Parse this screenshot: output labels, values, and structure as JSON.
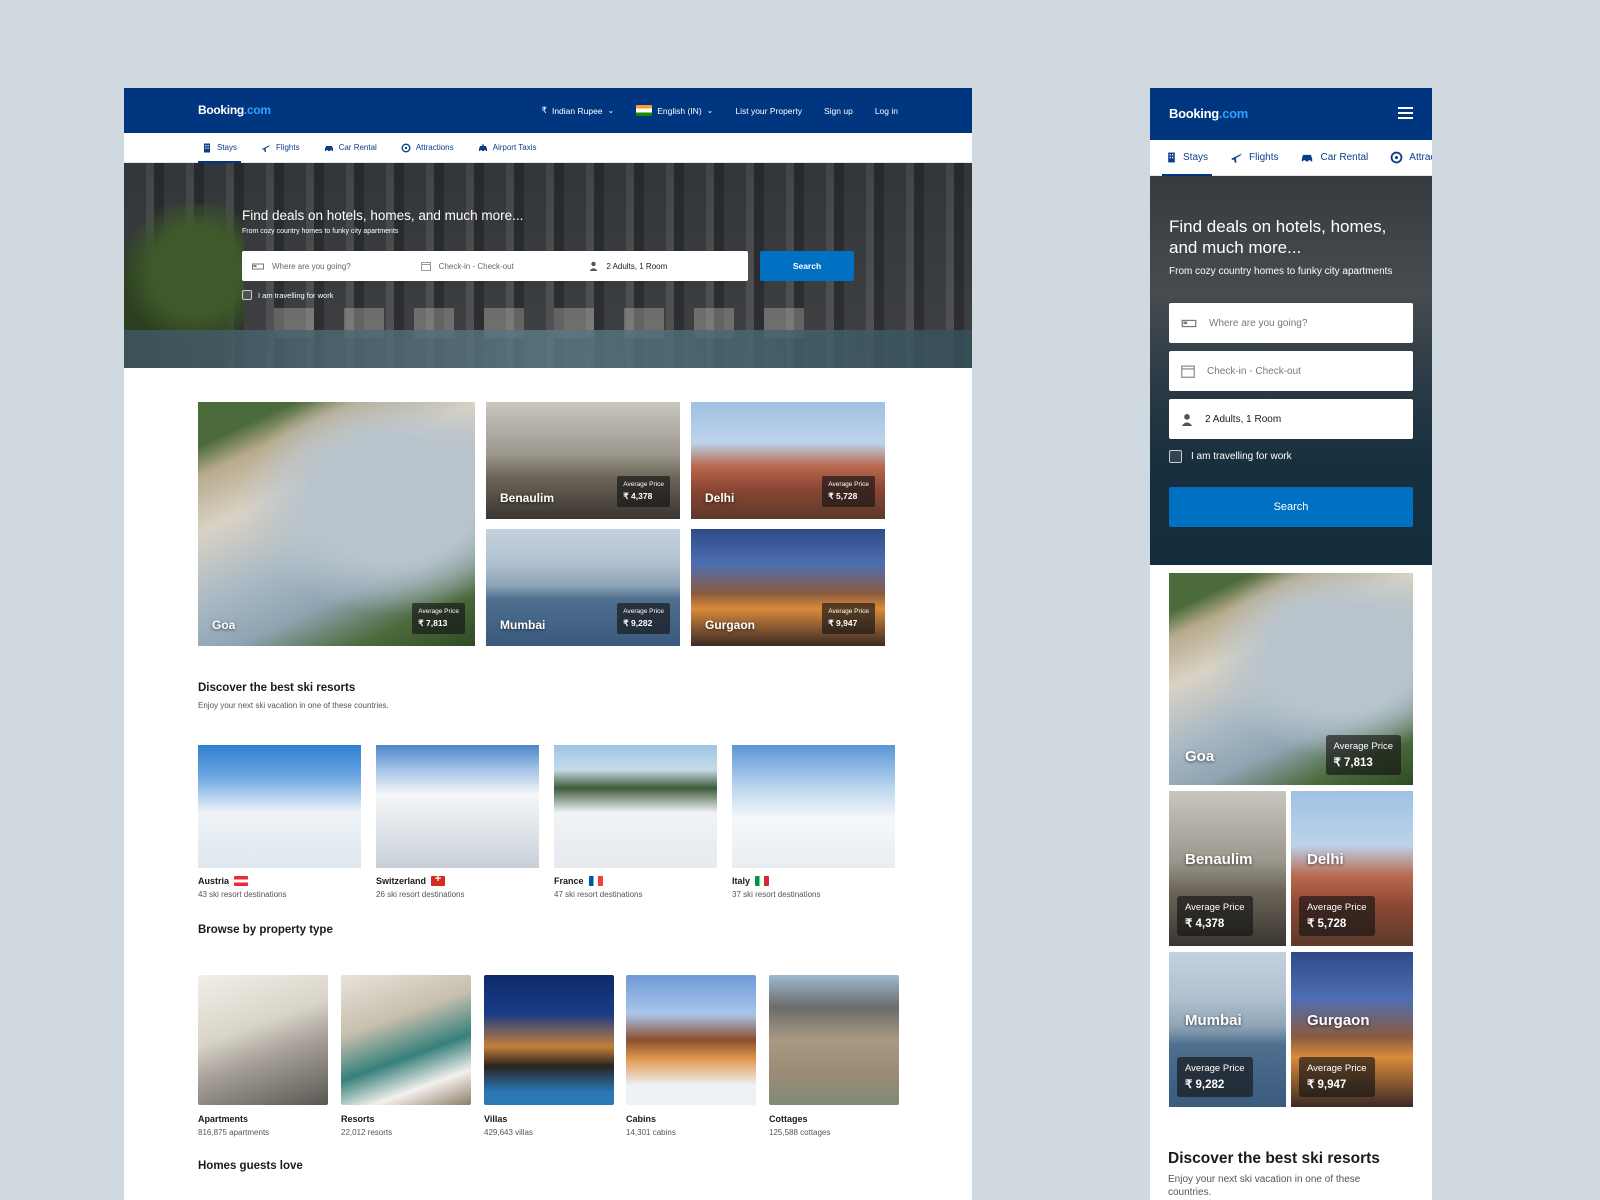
{
  "brand": {
    "name": "Booking",
    "suffix": ".com"
  },
  "header": {
    "currency": "Indian Rupee",
    "language": "English (IN)",
    "list_property": "List your Property",
    "sign_up": "Sign up",
    "log_in": "Log in"
  },
  "tabs": [
    {
      "label": "Stays",
      "icon": "building-icon"
    },
    {
      "label": "Flights",
      "icon": "plane-icon"
    },
    {
      "label": "Car Rental",
      "icon": "car-icon"
    },
    {
      "label": "Attractions",
      "icon": "attractions-icon"
    },
    {
      "label": "Airport Taxis",
      "icon": "taxi-icon"
    }
  ],
  "mobile_tabs": [
    "Stays",
    "Flights",
    "Car Rental",
    "Attractions"
  ],
  "hero": {
    "title": "Find deals on hotels, homes, and much more...",
    "subtitle": "From cozy country homes to funky city apartments",
    "destination_placeholder": "Where are you going?",
    "dates_placeholder": "Check-in - Check-out",
    "guests": "2 Adults, 1 Room",
    "search_label": "Search",
    "work_travel_label": "I am travelling for work"
  },
  "destinations": [
    {
      "name": "Goa",
      "price_label": "Average Price",
      "price": "₹ 7,813"
    },
    {
      "name": "Benaulim",
      "price_label": "Average Price",
      "price": "₹ 4,378"
    },
    {
      "name": "Delhi",
      "price_label": "Average Price",
      "price": "₹ 5,728"
    },
    {
      "name": "Mumbai",
      "price_label": "Average Price",
      "price": "₹ 9,282"
    },
    {
      "name": "Gurgaon",
      "price_label": "Average Price",
      "price": "₹ 9,947"
    }
  ],
  "ski": {
    "title": "Discover the best ski resorts",
    "subtitle": "Enjoy your next ski vacation in one of these countries.",
    "items": [
      {
        "country": "Austria",
        "count": "43 ski resort destinations"
      },
      {
        "country": "Switzerland",
        "count": "26 ski resort destinations"
      },
      {
        "country": "France",
        "count": "47 ski resort destinations"
      },
      {
        "country": "Italy",
        "count": "37 ski resort destinations"
      }
    ]
  },
  "property_types": {
    "title": "Browse by property type",
    "items": [
      {
        "name": "Apartments",
        "count": "816,875 apartments"
      },
      {
        "name": "Resorts",
        "count": "22,012 resorts"
      },
      {
        "name": "Villas",
        "count": "429,643 villas"
      },
      {
        "name": "Cabins",
        "count": "14,301 cabins"
      },
      {
        "name": "Cottages",
        "count": "125,588 cottages"
      }
    ]
  },
  "homes_title": "Homes guests love",
  "mobile_ski_subtitle": "Enjoy your next ski vacation in one of these countries.",
  "colors": {
    "brand_blue": "#003580",
    "action_blue": "#0071c2",
    "page_bg": "#d0d8e0"
  }
}
